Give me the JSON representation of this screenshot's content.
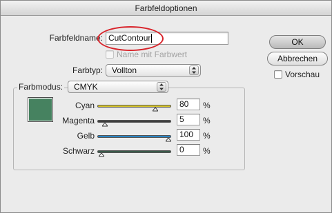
{
  "window": {
    "title": "Farbfeldoptionen"
  },
  "swatch_name": {
    "label": "Farbfeldname:",
    "value": "CutContour"
  },
  "name_with_value": {
    "label": "Name mit Farbwert",
    "enabled": false
  },
  "color_type": {
    "label": "Farbtyp:",
    "value": "Vollton"
  },
  "color_mode": {
    "label": "Farbmodus:",
    "value": "CMYK"
  },
  "buttons": {
    "ok": "OK",
    "cancel": "Abbrechen"
  },
  "preview": {
    "label": "Vorschau",
    "checked": false
  },
  "swatch_color": "#468260",
  "channels": [
    {
      "name": "Cyan",
      "value": "80",
      "unit": "%",
      "level": 0.8,
      "track_color": "#d7c52a"
    },
    {
      "name": "Magenta",
      "value": "5",
      "unit": "%",
      "level": 0.05,
      "track_color": "#3e3e3e"
    },
    {
      "name": "Gelb",
      "value": "100",
      "unit": "%",
      "level": 1.0,
      "track_color": "#2a86c6"
    },
    {
      "name": "Schwarz",
      "value": "0",
      "unit": "%",
      "level": 0.0,
      "track_color": "#3a5a4a"
    }
  ]
}
